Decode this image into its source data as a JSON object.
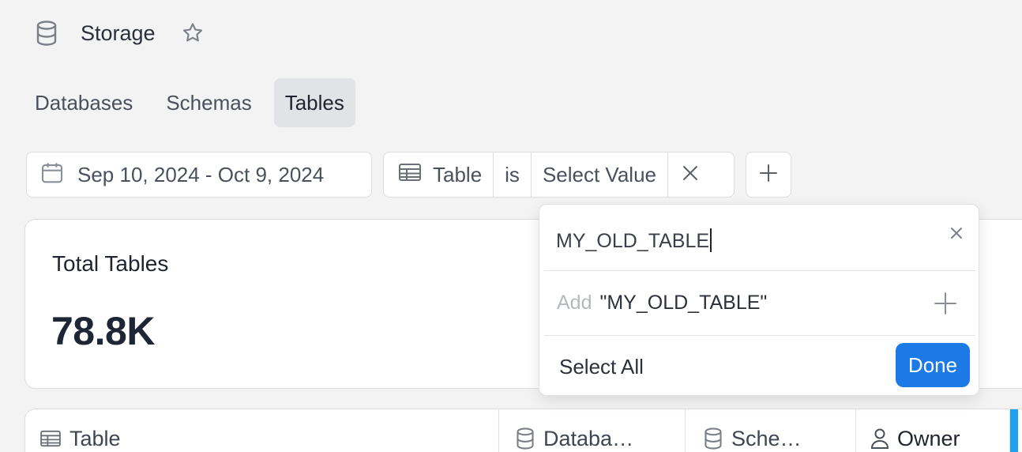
{
  "header": {
    "title": "Storage",
    "icon": "database-icon",
    "star_icon": "star-icon"
  },
  "tabs": [
    {
      "label": "Databases",
      "active": false
    },
    {
      "label": "Schemas",
      "active": false
    },
    {
      "label": "Tables",
      "active": true
    }
  ],
  "filters": {
    "date_range": "Sep 10, 2024 - Oct 9, 2024",
    "field": "Table",
    "operator": "is",
    "value": "Select Value"
  },
  "card": {
    "title": "Total Tables",
    "value": "78.8K"
  },
  "table": {
    "columns": [
      {
        "label": "Table",
        "icon": "table-icon"
      },
      {
        "label": "Databa…",
        "icon": "database-icon"
      },
      {
        "label": "Sche…",
        "icon": "database-icon"
      },
      {
        "label": "Owner",
        "icon": "user-icon"
      }
    ]
  },
  "popover": {
    "search_value": "MY_OLD_TABLE",
    "add_prefix": "Add",
    "add_value": "\"MY_OLD_TABLE\"",
    "select_all": "Select All",
    "done": "Done"
  },
  "colors": {
    "accent": "#1b7ae6",
    "scroll_accent": "#1da1f2"
  }
}
